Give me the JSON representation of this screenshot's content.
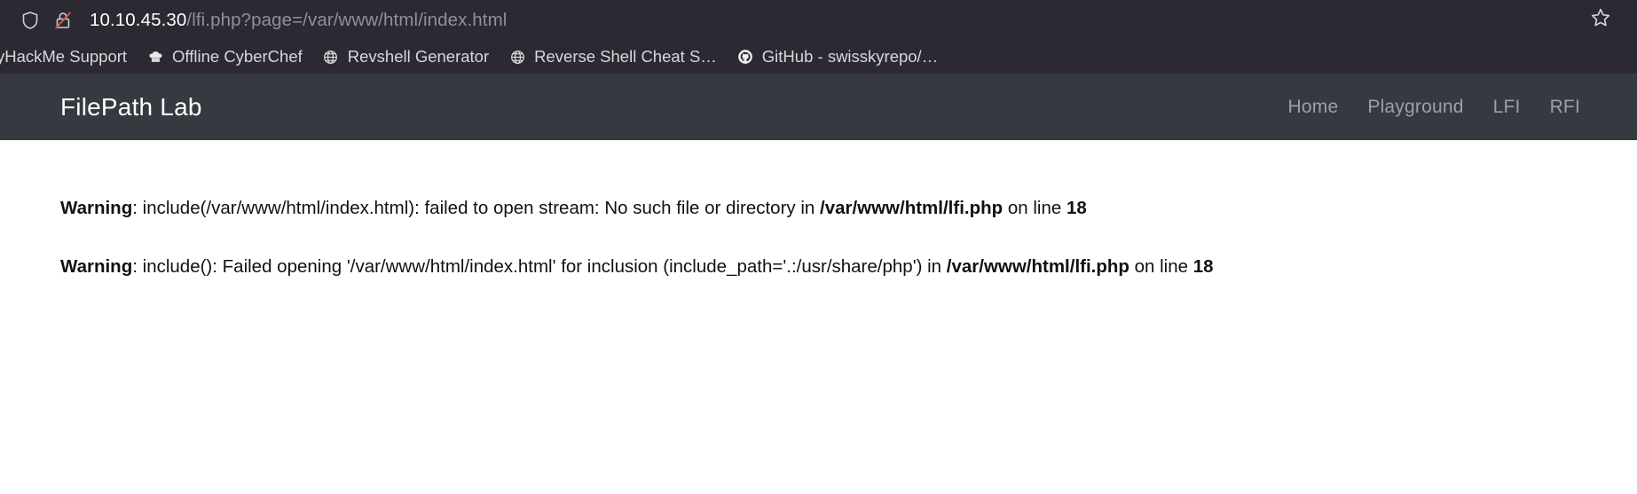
{
  "browser": {
    "url": {
      "host": "10.10.45.30",
      "path": "/lfi.php?page=/var/www/html/index.html",
      "shield_icon": "shield-icon",
      "lock_icon": "lock-broken-icon",
      "bookmark_icon": "star-icon"
    },
    "bookmarks": [
      {
        "label": "yHackMe Support",
        "icon": "none"
      },
      {
        "label": "Offline CyberChef",
        "icon": "chef-hat-icon"
      },
      {
        "label": "Revshell Generator",
        "icon": "globe-icon"
      },
      {
        "label": "Reverse Shell Cheat S…",
        "icon": "globe-icon"
      },
      {
        "label": "GitHub - swisskyrepo/…",
        "icon": "github-icon"
      }
    ]
  },
  "navbar": {
    "brand": "FilePath Lab",
    "links": [
      {
        "label": "Home"
      },
      {
        "label": "Playground"
      },
      {
        "label": "LFI"
      },
      {
        "label": "RFI"
      }
    ]
  },
  "main": {
    "warnings": [
      {
        "label": "Warning",
        "sep": ": ",
        "text1": "include(/var/www/html/index.html): failed to open stream: No such file or directory in ",
        "file": "/var/www/html/lfi.php",
        "text2": " on line ",
        "line": "18"
      },
      {
        "label": "Warning",
        "sep": ": ",
        "text1": "include(): Failed opening '/var/www/html/index.html' for inclusion (include_path='.:/usr/share/php') in ",
        "file": "/var/www/html/lfi.php",
        "text2": " on line ",
        "line": "18"
      }
    ]
  },
  "colors": {
    "chrome_bg": "#2b2a33",
    "navbar_bg": "#343a40",
    "page_bg": "#ffffff",
    "url_host": "#ffffff",
    "url_path": "#8f8f9d",
    "navlink": "#9aa0a6"
  }
}
